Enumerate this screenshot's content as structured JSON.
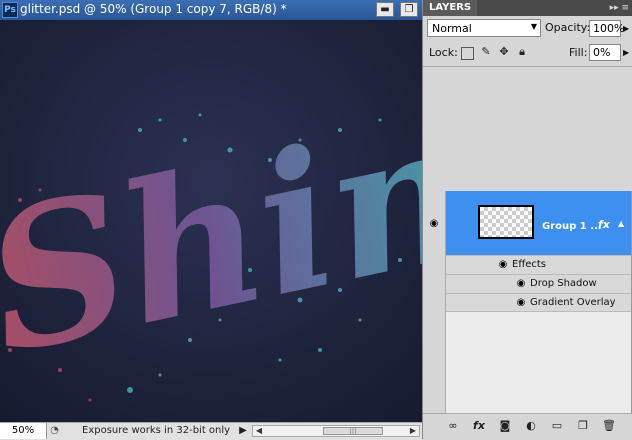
{
  "document": {
    "title": "glitter.psd @ 50% (Group 1 copy 7, RGB/8) *",
    "app_logo": "Ps",
    "window_buttons": [
      "minimize-icon",
      "restore-icon"
    ],
    "canvas_text": "Shin",
    "colors": {
      "background": "#1f2540",
      "pink": "#c0566d",
      "purple": "#7a5b9e",
      "teal": "#4fb0bd"
    }
  },
  "status_bar": {
    "zoom": "50%",
    "message": "Exposure works in 32-bit only"
  },
  "layers_panel": {
    "tab": "LAYERS",
    "blend_mode": "Normal",
    "opacity_label": "Opacity:",
    "opacity_value": "100%",
    "lock_label": "Lock:",
    "fill_label": "Fill:",
    "fill_value": "0%",
    "layer": {
      "name": "Group 1 ...",
      "fx": "fx",
      "selected_color": "#3d8ff0"
    },
    "effects_label": "Effects",
    "effects": [
      "Drop Shadow",
      "Gradient Overlay"
    ],
    "footer_icons": [
      "link-icon",
      "fx-icon",
      "mask-icon",
      "adjustment-icon",
      "folder-icon",
      "new-layer-icon",
      "trash-icon"
    ]
  }
}
